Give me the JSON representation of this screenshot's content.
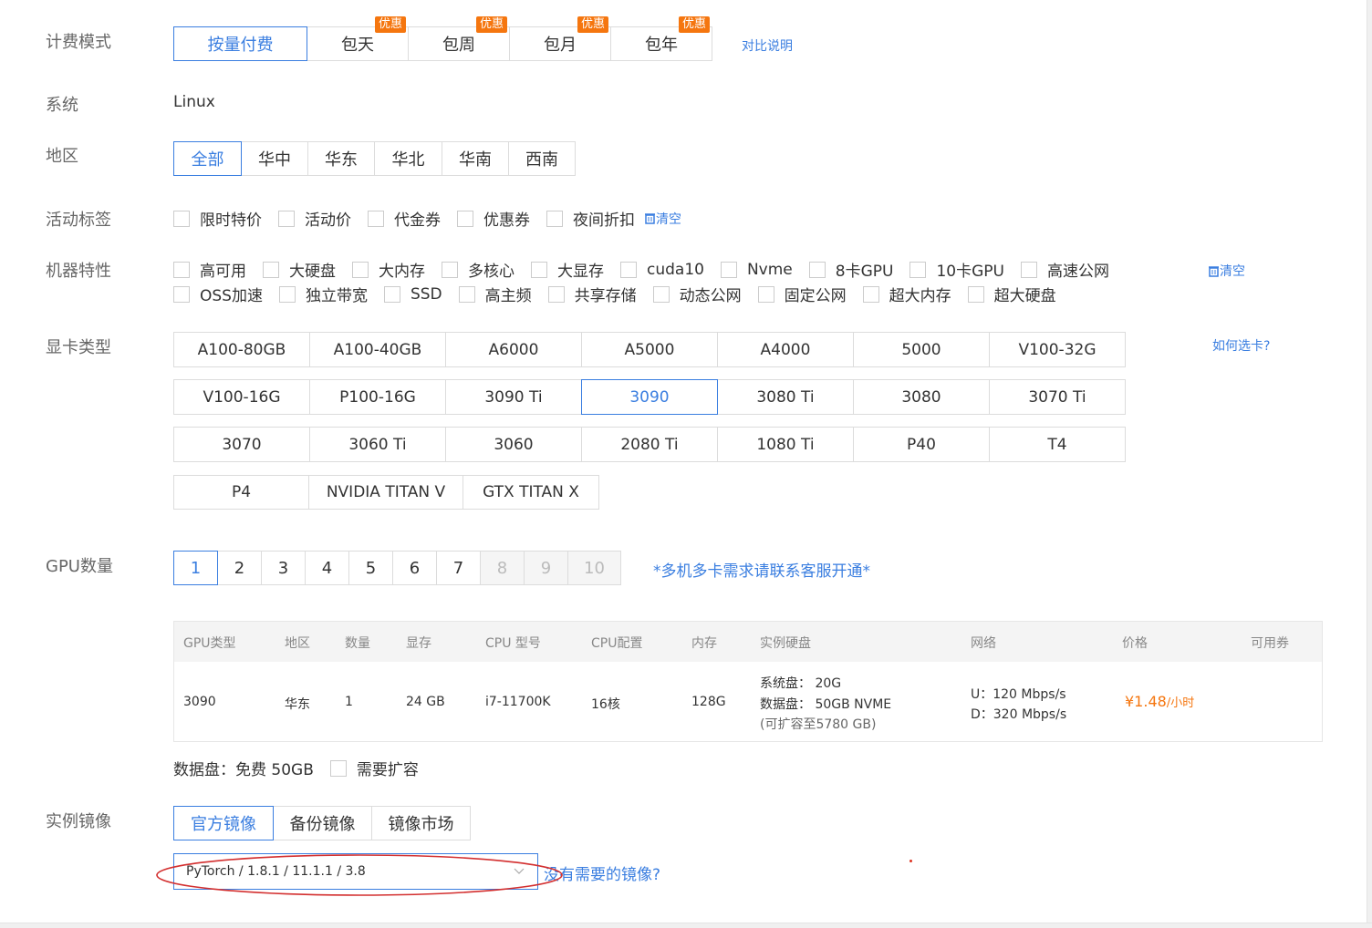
{
  "billing": {
    "label": "计费模式",
    "options": [
      {
        "label": "按量付费",
        "badge": ""
      },
      {
        "label": "包天",
        "badge": "优惠"
      },
      {
        "label": "包周",
        "badge": "优惠"
      },
      {
        "label": "包月",
        "badge": "优惠"
      },
      {
        "label": "包年",
        "badge": "优惠"
      }
    ],
    "active_index": 0,
    "compare_link": "对比说明"
  },
  "system": {
    "label": "系统",
    "value": "Linux"
  },
  "region": {
    "label": "地区",
    "options": [
      "全部",
      "华中",
      "华东",
      "华北",
      "华南",
      "西南"
    ],
    "active_index": 0
  },
  "activity_tags": {
    "label": "活动标签",
    "options": [
      "限时特价",
      "活动价",
      "代金券",
      "优惠券",
      "夜间折扣"
    ],
    "clear_label": "清空"
  },
  "machine_features": {
    "label": "机器特性",
    "row1": [
      "高可用",
      "大硬盘",
      "大内存",
      "多核心",
      "大显存",
      "cuda10",
      "Nvme",
      "8卡GPU",
      "10卡GPU",
      "高速公网"
    ],
    "row2": [
      "OSS加速",
      "独立带宽",
      "SSD",
      "高主频",
      "共享存储",
      "动态公网",
      "固定公网",
      "超大内存",
      "超大硬盘"
    ],
    "clear_label": "清空"
  },
  "gpu_type": {
    "label": "显卡类型",
    "help_link": "如何选卡?",
    "rows": [
      [
        "A100-80GB",
        "A100-40GB",
        "A6000",
        "A5000",
        "A4000",
        "5000",
        "V100-32G"
      ],
      [
        "V100-16G",
        "P100-16G",
        "3090 Ti",
        "3090",
        "3080 Ti",
        "3080",
        "3070 Ti"
      ],
      [
        "3070",
        "3060 Ti",
        "3060",
        "2080 Ti",
        "1080 Ti",
        "P40",
        "T4"
      ],
      [
        "P4",
        "NVIDIA TITAN V",
        "GTX TITAN X"
      ]
    ],
    "active": "3090"
  },
  "gpu_count": {
    "label": "GPU数量",
    "options": [
      "1",
      "2",
      "3",
      "4",
      "5",
      "6",
      "7",
      "8",
      "9",
      "10"
    ],
    "disabled": [
      "8",
      "9",
      "10"
    ],
    "active_index": 0,
    "note": "*多机多卡需求请联系客服开通*"
  },
  "spec_table": {
    "headers": [
      "GPU类型",
      "地区",
      "数量",
      "显存",
      "CPU 型号",
      "CPU配置",
      "内存",
      "实例硬盘",
      "网络",
      "价格",
      "可用券"
    ],
    "row": {
      "gpu": "3090",
      "region": "华东",
      "count": "1",
      "vram": "24 GB",
      "cpu_model": "i7-11700K",
      "cpu_cores": "16核",
      "memory": "128G",
      "disk_system": "系统盘：  20G",
      "disk_data": "数据盘：  50GB NVME",
      "disk_expand": "(可扩容至5780 GB)",
      "net_up": "U：120 Mbps/s",
      "net_down": "D：320 Mbps/s",
      "price": "¥1.48",
      "price_unit": "/小时"
    }
  },
  "data_disk": {
    "text": "数据盘：免费 50GB",
    "expand_label": "需要扩容"
  },
  "image": {
    "label": "实例镜像",
    "tabs": [
      "官方镜像",
      "备份镜像",
      "镜像市场"
    ],
    "active_index": 0,
    "selected": "PyTorch / 1.8.1 / 11.1.1 / 3.8",
    "missing_link": "没有需要的镜像?"
  },
  "colors": {
    "accent": "#3a7ee0",
    "badge": "#f5760f",
    "price": "#f5760f",
    "annotation": "#d32f2f"
  }
}
